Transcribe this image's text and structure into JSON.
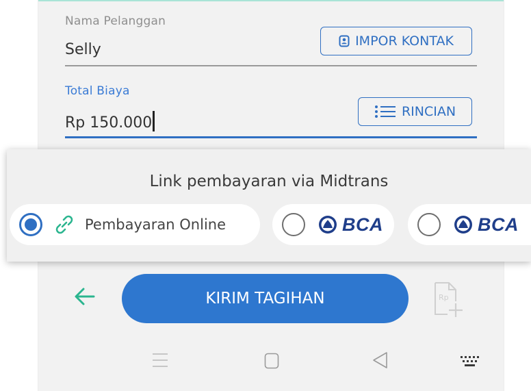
{
  "form": {
    "customer": {
      "label": "Nama Pelanggan",
      "value": "Selly",
      "import_label": "IMPOR KONTAK"
    },
    "total": {
      "label": "Total Biaya",
      "value": "Rp 150.000",
      "details_label": "RINCIAN"
    }
  },
  "payment_sheet": {
    "title": "Link pembayaran via Midtrans",
    "options": [
      {
        "label": "Pembayaran Online",
        "selected": true,
        "icon": "link-icon"
      },
      {
        "label": "BCA",
        "selected": false,
        "icon": "bca-logo"
      },
      {
        "label": "BCA",
        "selected": false,
        "icon": "bca-logo"
      }
    ]
  },
  "actions": {
    "back_icon": "arrow-left-icon",
    "send_label": "KIRIM TAGIHAN",
    "invoice_icon": "add-invoice-icon"
  },
  "nav_bar": {
    "icons": [
      "menu-icon",
      "home-icon",
      "back-icon",
      "keyboard-icon"
    ]
  },
  "colors": {
    "accent": "#2e77cf",
    "teal": "#2bb58f",
    "bca_blue": "#1f3e8a"
  }
}
